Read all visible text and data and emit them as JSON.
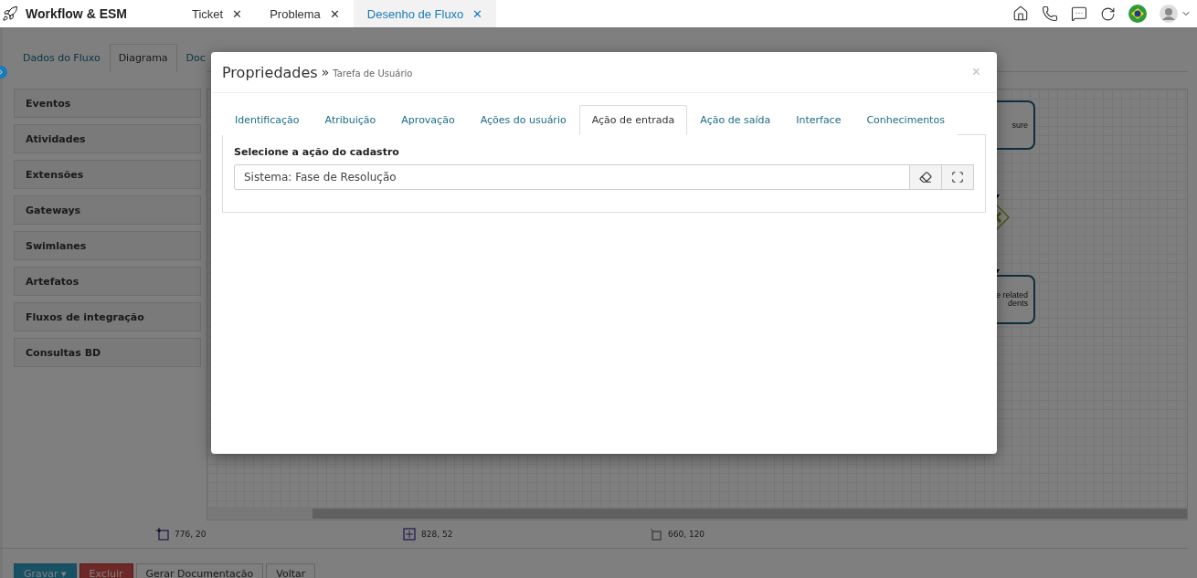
{
  "app": {
    "title": "Workflow & ESM"
  },
  "tabs": [
    {
      "label": "Ticket",
      "close": "✕",
      "selected": false
    },
    {
      "label": "Problema",
      "close": "✕",
      "selected": false
    },
    {
      "label": "Desenho de Fluxo",
      "close": "✕",
      "selected": true
    }
  ],
  "page": {
    "tabs": [
      {
        "label": "Dados do Fluxo",
        "selected": false
      },
      {
        "label": "Diagrama",
        "selected": true
      },
      {
        "label": "Doc",
        "selected": false
      }
    ],
    "palette": [
      "Eventos",
      "Atividades",
      "Extensões",
      "Gateways",
      "Swimlanes",
      "Artefatos",
      "Fluxos de integração",
      "Consultas BD"
    ],
    "nodes": [
      {
        "kind": "task",
        "lines": [
          "sure"
        ]
      },
      {
        "kind": "gateway"
      },
      {
        "kind": "task",
        "lines": [
          "e related",
          "dents"
        ]
      }
    ],
    "coords": [
      {
        "kind": "position",
        "text": "776, 20"
      },
      {
        "kind": "size",
        "text": "828, 52"
      },
      {
        "kind": "resize",
        "text": "660, 120"
      }
    ],
    "buttons": [
      {
        "label": "Gravar ▾",
        "kind": "primary"
      },
      {
        "label": "Excluir",
        "kind": "danger"
      },
      {
        "label": "Gerar Documentação",
        "kind": "default"
      },
      {
        "label": "Voltar",
        "kind": "default"
      }
    ]
  },
  "modal": {
    "title": "Propriedades",
    "separator": "»",
    "subtitle": "Tarefa de Usuário",
    "close": "×",
    "tabs": [
      {
        "label": "Identificação",
        "selected": false
      },
      {
        "label": "Atribuição",
        "selected": false
      },
      {
        "label": "Aprovação",
        "selected": false
      },
      {
        "label": "Ações do usuário",
        "selected": false
      },
      {
        "label": "Ação de entrada",
        "selected": true
      },
      {
        "label": "Ação de saída",
        "selected": false
      },
      {
        "label": "Interface",
        "selected": false
      },
      {
        "label": "Conhecimentos",
        "selected": false
      }
    ],
    "field_label": "Selecione a ação do cadastro",
    "field_value": "Sistema: Fase de Resolução"
  }
}
